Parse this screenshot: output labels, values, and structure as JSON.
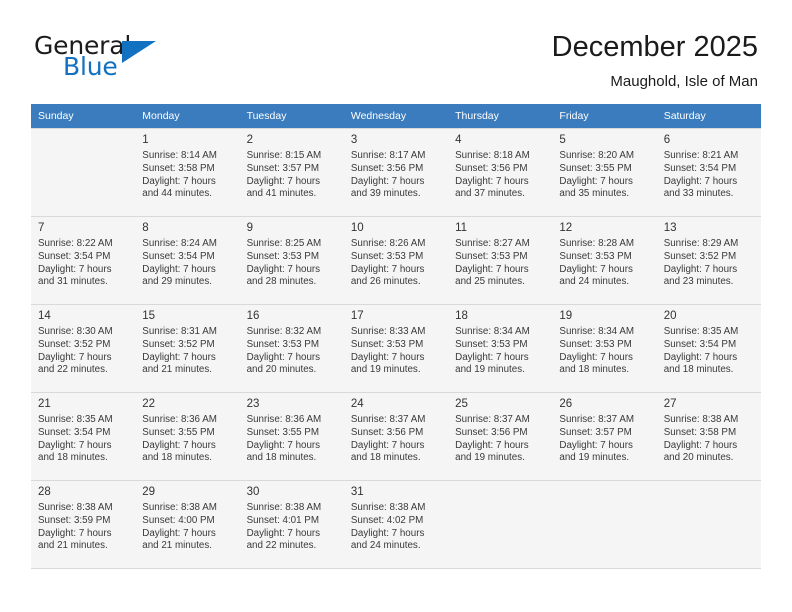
{
  "brand": {
    "name_part1": "General",
    "name_part2": "Blue",
    "accent_color": "#1271c0"
  },
  "header": {
    "title": "December 2025",
    "subtitle": "Maughold, Isle of Man"
  },
  "theme": {
    "header_row_bg": "#3a7cbe",
    "alt_row_bg": "#f5f5f5",
    "grid_line": "#d9d9d9"
  },
  "weekdays": [
    "Sunday",
    "Monday",
    "Tuesday",
    "Wednesday",
    "Thursday",
    "Friday",
    "Saturday"
  ],
  "weeks": [
    [
      {
        "day": "",
        "sunrise": "",
        "sunset": "",
        "daylight1": "",
        "daylight2": ""
      },
      {
        "day": "1",
        "sunrise": "Sunrise: 8:14 AM",
        "sunset": "Sunset: 3:58 PM",
        "daylight1": "Daylight: 7 hours",
        "daylight2": "and 44 minutes."
      },
      {
        "day": "2",
        "sunrise": "Sunrise: 8:15 AM",
        "sunset": "Sunset: 3:57 PM",
        "daylight1": "Daylight: 7 hours",
        "daylight2": "and 41 minutes."
      },
      {
        "day": "3",
        "sunrise": "Sunrise: 8:17 AM",
        "sunset": "Sunset: 3:56 PM",
        "daylight1": "Daylight: 7 hours",
        "daylight2": "and 39 minutes."
      },
      {
        "day": "4",
        "sunrise": "Sunrise: 8:18 AM",
        "sunset": "Sunset: 3:56 PM",
        "daylight1": "Daylight: 7 hours",
        "daylight2": "and 37 minutes."
      },
      {
        "day": "5",
        "sunrise": "Sunrise: 8:20 AM",
        "sunset": "Sunset: 3:55 PM",
        "daylight1": "Daylight: 7 hours",
        "daylight2": "and 35 minutes."
      },
      {
        "day": "6",
        "sunrise": "Sunrise: 8:21 AM",
        "sunset": "Sunset: 3:54 PM",
        "daylight1": "Daylight: 7 hours",
        "daylight2": "and 33 minutes."
      }
    ],
    [
      {
        "day": "7",
        "sunrise": "Sunrise: 8:22 AM",
        "sunset": "Sunset: 3:54 PM",
        "daylight1": "Daylight: 7 hours",
        "daylight2": "and 31 minutes."
      },
      {
        "day": "8",
        "sunrise": "Sunrise: 8:24 AM",
        "sunset": "Sunset: 3:54 PM",
        "daylight1": "Daylight: 7 hours",
        "daylight2": "and 29 minutes."
      },
      {
        "day": "9",
        "sunrise": "Sunrise: 8:25 AM",
        "sunset": "Sunset: 3:53 PM",
        "daylight1": "Daylight: 7 hours",
        "daylight2": "and 28 minutes."
      },
      {
        "day": "10",
        "sunrise": "Sunrise: 8:26 AM",
        "sunset": "Sunset: 3:53 PM",
        "daylight1": "Daylight: 7 hours",
        "daylight2": "and 26 minutes."
      },
      {
        "day": "11",
        "sunrise": "Sunrise: 8:27 AM",
        "sunset": "Sunset: 3:53 PM",
        "daylight1": "Daylight: 7 hours",
        "daylight2": "and 25 minutes."
      },
      {
        "day": "12",
        "sunrise": "Sunrise: 8:28 AM",
        "sunset": "Sunset: 3:53 PM",
        "daylight1": "Daylight: 7 hours",
        "daylight2": "and 24 minutes."
      },
      {
        "day": "13",
        "sunrise": "Sunrise: 8:29 AM",
        "sunset": "Sunset: 3:52 PM",
        "daylight1": "Daylight: 7 hours",
        "daylight2": "and 23 minutes."
      }
    ],
    [
      {
        "day": "14",
        "sunrise": "Sunrise: 8:30 AM",
        "sunset": "Sunset: 3:52 PM",
        "daylight1": "Daylight: 7 hours",
        "daylight2": "and 22 minutes."
      },
      {
        "day": "15",
        "sunrise": "Sunrise: 8:31 AM",
        "sunset": "Sunset: 3:52 PM",
        "daylight1": "Daylight: 7 hours",
        "daylight2": "and 21 minutes."
      },
      {
        "day": "16",
        "sunrise": "Sunrise: 8:32 AM",
        "sunset": "Sunset: 3:53 PM",
        "daylight1": "Daylight: 7 hours",
        "daylight2": "and 20 minutes."
      },
      {
        "day": "17",
        "sunrise": "Sunrise: 8:33 AM",
        "sunset": "Sunset: 3:53 PM",
        "daylight1": "Daylight: 7 hours",
        "daylight2": "and 19 minutes."
      },
      {
        "day": "18",
        "sunrise": "Sunrise: 8:34 AM",
        "sunset": "Sunset: 3:53 PM",
        "daylight1": "Daylight: 7 hours",
        "daylight2": "and 19 minutes."
      },
      {
        "day": "19",
        "sunrise": "Sunrise: 8:34 AM",
        "sunset": "Sunset: 3:53 PM",
        "daylight1": "Daylight: 7 hours",
        "daylight2": "and 18 minutes."
      },
      {
        "day": "20",
        "sunrise": "Sunrise: 8:35 AM",
        "sunset": "Sunset: 3:54 PM",
        "daylight1": "Daylight: 7 hours",
        "daylight2": "and 18 minutes."
      }
    ],
    [
      {
        "day": "21",
        "sunrise": "Sunrise: 8:35 AM",
        "sunset": "Sunset: 3:54 PM",
        "daylight1": "Daylight: 7 hours",
        "daylight2": "and 18 minutes."
      },
      {
        "day": "22",
        "sunrise": "Sunrise: 8:36 AM",
        "sunset": "Sunset: 3:55 PM",
        "daylight1": "Daylight: 7 hours",
        "daylight2": "and 18 minutes."
      },
      {
        "day": "23",
        "sunrise": "Sunrise: 8:36 AM",
        "sunset": "Sunset: 3:55 PM",
        "daylight1": "Daylight: 7 hours",
        "daylight2": "and 18 minutes."
      },
      {
        "day": "24",
        "sunrise": "Sunrise: 8:37 AM",
        "sunset": "Sunset: 3:56 PM",
        "daylight1": "Daylight: 7 hours",
        "daylight2": "and 18 minutes."
      },
      {
        "day": "25",
        "sunrise": "Sunrise: 8:37 AM",
        "sunset": "Sunset: 3:56 PM",
        "daylight1": "Daylight: 7 hours",
        "daylight2": "and 19 minutes."
      },
      {
        "day": "26",
        "sunrise": "Sunrise: 8:37 AM",
        "sunset": "Sunset: 3:57 PM",
        "daylight1": "Daylight: 7 hours",
        "daylight2": "and 19 minutes."
      },
      {
        "day": "27",
        "sunrise": "Sunrise: 8:38 AM",
        "sunset": "Sunset: 3:58 PM",
        "daylight1": "Daylight: 7 hours",
        "daylight2": "and 20 minutes."
      }
    ],
    [
      {
        "day": "28",
        "sunrise": "Sunrise: 8:38 AM",
        "sunset": "Sunset: 3:59 PM",
        "daylight1": "Daylight: 7 hours",
        "daylight2": "and 21 minutes."
      },
      {
        "day": "29",
        "sunrise": "Sunrise: 8:38 AM",
        "sunset": "Sunset: 4:00 PM",
        "daylight1": "Daylight: 7 hours",
        "daylight2": "and 21 minutes."
      },
      {
        "day": "30",
        "sunrise": "Sunrise: 8:38 AM",
        "sunset": "Sunset: 4:01 PM",
        "daylight1": "Daylight: 7 hours",
        "daylight2": "and 22 minutes."
      },
      {
        "day": "31",
        "sunrise": "Sunrise: 8:38 AM",
        "sunset": "Sunset: 4:02 PM",
        "daylight1": "Daylight: 7 hours",
        "daylight2": "and 24 minutes."
      },
      {
        "day": "",
        "sunrise": "",
        "sunset": "",
        "daylight1": "",
        "daylight2": ""
      },
      {
        "day": "",
        "sunrise": "",
        "sunset": "",
        "daylight1": "",
        "daylight2": ""
      },
      {
        "day": "",
        "sunrise": "",
        "sunset": "",
        "daylight1": "",
        "daylight2": ""
      }
    ]
  ]
}
